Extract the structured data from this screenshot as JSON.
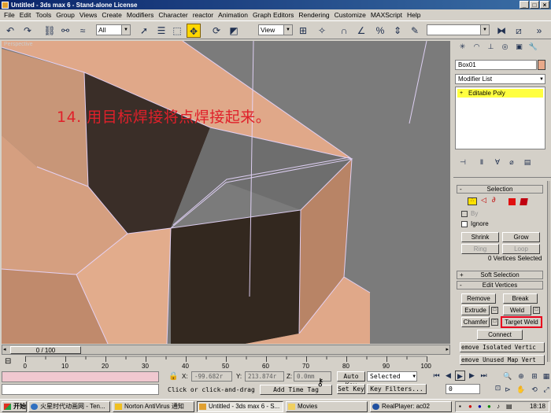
{
  "window": {
    "title": "Untitled - 3ds max 6 - Stand-alone License",
    "controls": [
      "_",
      "□",
      "×"
    ]
  },
  "menu": [
    "File",
    "Edit",
    "Tools",
    "Group",
    "Views",
    "Create",
    "Modifiers",
    "Character",
    "reactor",
    "Animation",
    "Graph Editors",
    "Rendering",
    "Customize",
    "MAXScript",
    "Help"
  ],
  "toolbar": {
    "selection_filter": "All",
    "ref_coord": "View",
    "named_sel": ""
  },
  "viewport": {
    "label": "Perspective",
    "caption": "14. 用目标焊接将点焊接起来。"
  },
  "command_panel": {
    "object_name": "Box01",
    "object_color": "#e8a98a",
    "modifier_list_label": "Modifier List",
    "stack_item": "Editable Poly",
    "selection_rollout": "Selection",
    "by_label": "By",
    "ignore_label": "Ignore",
    "shrink": "Shrink",
    "grow": "Grow",
    "ring": "Ring",
    "loop": "Loop",
    "status": "0 Vertices Selected",
    "soft_selection": "Soft Selection",
    "edit_vertices": "Edit Vertices",
    "remove": "Remove",
    "break": "Break",
    "extrude": "Extrude",
    "weld": "Weld",
    "chamfer": "Chamfer",
    "target_weld": "Target Weld",
    "connect": "Connect",
    "remove_isolated": "emove Isolated Vertic",
    "remove_unused": "emove Unused Map Vert"
  },
  "time": {
    "slider_label": "0 / 100",
    "ticks": [
      "0",
      "10",
      "20",
      "30",
      "40",
      "50",
      "60",
      "70",
      "80",
      "90",
      "100"
    ]
  },
  "status": {
    "x_label": "X:",
    "x_value": "-99.682r",
    "y_label": "Y:",
    "y_value": "213.874r",
    "z_label": "Z:",
    "z_value": "0.0mm",
    "prompt": "Click or click-and-drag",
    "add_time_tag": "Add Time Tag",
    "auto_key": "Auto Key",
    "set_key": "Set Key",
    "key_mode": "Selected",
    "key_filters": "Key Filters...",
    "frame": "0"
  },
  "taskbar": {
    "start": "开始",
    "tasks": [
      "火星时代动画网 - Ten...",
      "Norton AntiVirus 通知",
      "Untitled - 3ds max 6 - S...",
      "Movies",
      "RealPlayer: ac02"
    ],
    "clock": "18:18"
  },
  "colors": {
    "highlight": "#e8001c",
    "face": "#e8a98a",
    "dark_face": "#3a2e28",
    "selected_stack": "#ffff40"
  }
}
